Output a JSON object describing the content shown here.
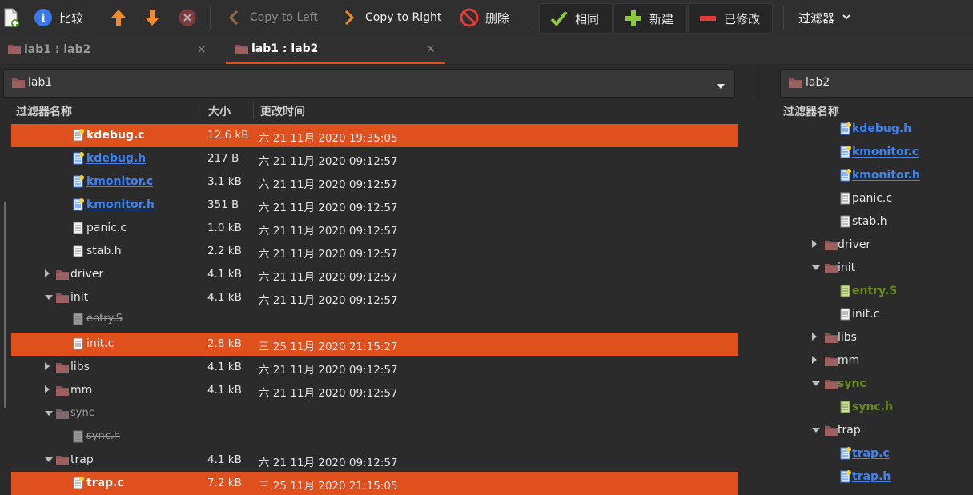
{
  "toolbar": {
    "info_label": "比较",
    "copy_left_label": "Copy to Left",
    "copy_right_label": "Copy to Right",
    "delete_label": "删除",
    "same_label": "相同",
    "new_label": "新建",
    "modified_label": "已修改",
    "filter_label": "过滤器"
  },
  "tabs": [
    {
      "label": "lab1 : lab2",
      "close": "×"
    },
    {
      "label": "lab1 : lab2",
      "close": "×"
    }
  ],
  "left_path": "lab1",
  "right_path": "lab2",
  "columns": {
    "name": "过滤器名称",
    "size": "大小",
    "time": "更改时间"
  },
  "right_column_name": "过滤器名称",
  "left_rows": [
    {
      "name": "kdebug.c",
      "size": "12.6 kB",
      "time": "六 21 11月 2020 19:35:05",
      "style": "bold",
      "hl": true,
      "kind": "file-new",
      "level": 2
    },
    {
      "name": "kdebug.h",
      "size": "217 B",
      "time": "六 21 11月 2020 09:12:57",
      "style": "blue",
      "hl": false,
      "kind": "file-blue",
      "level": 2
    },
    {
      "name": "kmonitor.c",
      "size": "3.1 kB",
      "time": "六 21 11月 2020 09:12:57",
      "style": "blue",
      "hl": false,
      "kind": "file-blue",
      "level": 2
    },
    {
      "name": "kmonitor.h",
      "size": "351 B",
      "time": "六 21 11月 2020 09:12:57",
      "style": "blue",
      "hl": false,
      "kind": "file-blue",
      "level": 2
    },
    {
      "name": "panic.c",
      "size": "1.0 kB",
      "time": "六 21 11月 2020 09:12:57",
      "style": "normal",
      "hl": false,
      "kind": "file",
      "level": 2
    },
    {
      "name": "stab.h",
      "size": "2.2 kB",
      "time": "六 21 11月 2020 09:12:57",
      "style": "normal",
      "hl": false,
      "kind": "file",
      "level": 2
    },
    {
      "name": "driver",
      "size": "4.1 kB",
      "time": "六 21 11月 2020 09:12:57",
      "style": "normal",
      "hl": false,
      "kind": "folder",
      "level": 1,
      "expander": "right"
    },
    {
      "name": "init",
      "size": "4.1 kB",
      "time": "六 21 11月 2020 09:12:57",
      "style": "normal",
      "hl": false,
      "kind": "folder",
      "level": 1,
      "expander": "down"
    },
    {
      "name": "entry.S",
      "size": "",
      "time": "",
      "style": "strike",
      "hl": false,
      "kind": "file-grey",
      "level": 2
    },
    {
      "name": "init.c",
      "size": "2.8 kB",
      "time": "三 25 11月 2020 21:15:27",
      "style": "normal",
      "hl": true,
      "kind": "file",
      "level": 2
    },
    {
      "name": "libs",
      "size": "4.1 kB",
      "time": "六 21 11月 2020 09:12:57",
      "style": "normal",
      "hl": false,
      "kind": "folder",
      "level": 1,
      "expander": "right"
    },
    {
      "name": "mm",
      "size": "4.1 kB",
      "time": "六 21 11月 2020 09:12:57",
      "style": "normal",
      "hl": false,
      "kind": "folder",
      "level": 1,
      "expander": "right"
    },
    {
      "name": "sync",
      "size": "",
      "time": "",
      "style": "strike",
      "hl": false,
      "kind": "folder-grey",
      "level": 1,
      "expander": "down"
    },
    {
      "name": "sync.h",
      "size": "",
      "time": "",
      "style": "strike",
      "hl": false,
      "kind": "file-grey",
      "level": 2
    },
    {
      "name": "trap",
      "size": "4.1 kB",
      "time": "六 21 11月 2020 09:12:57",
      "style": "normal",
      "hl": false,
      "kind": "folder",
      "level": 1,
      "expander": "down"
    },
    {
      "name": "trap.c",
      "size": "7.2 kB",
      "time": "三 25 11月 2020 21:15:05",
      "style": "bold",
      "hl": true,
      "kind": "file-new",
      "level": 2
    }
  ],
  "right_rows": [
    {
      "name": "kdebug.h",
      "style": "blue",
      "kind": "file-blue",
      "level": 2
    },
    {
      "name": "kmonitor.c",
      "style": "blue",
      "kind": "file-blue",
      "level": 2
    },
    {
      "name": "kmonitor.h",
      "style": "blue",
      "kind": "file-blue",
      "level": 2
    },
    {
      "name": "panic.c",
      "style": "normal",
      "kind": "file",
      "level": 2
    },
    {
      "name": "stab.h",
      "style": "normal",
      "kind": "file",
      "level": 2
    },
    {
      "name": "driver",
      "style": "normal",
      "kind": "folder",
      "level": 1,
      "expander": "right"
    },
    {
      "name": "init",
      "style": "normal",
      "kind": "folder",
      "level": 1,
      "expander": "down"
    },
    {
      "name": "entry.S",
      "style": "olive",
      "kind": "file-olive",
      "level": 2
    },
    {
      "name": "init.c",
      "style": "normal",
      "kind": "file",
      "level": 2
    },
    {
      "name": "libs",
      "style": "normal",
      "kind": "folder",
      "level": 1,
      "expander": "right"
    },
    {
      "name": "mm",
      "style": "normal",
      "kind": "folder",
      "level": 1,
      "expander": "right"
    },
    {
      "name": "sync",
      "style": "olive",
      "kind": "folder",
      "level": 1,
      "expander": "down"
    },
    {
      "name": "sync.h",
      "style": "olive",
      "kind": "file-olive",
      "level": 2
    },
    {
      "name": "trap",
      "style": "normal",
      "kind": "folder",
      "level": 1,
      "expander": "down"
    },
    {
      "name": "trap.c",
      "style": "blue",
      "kind": "file-blue",
      "level": 2
    },
    {
      "name": "trap.h",
      "style": "blue",
      "kind": "file-blue",
      "level": 2
    }
  ],
  "colors": {
    "highlight": "#e0501c",
    "blue": "#3f82f2",
    "olive": "#6b8e23"
  }
}
